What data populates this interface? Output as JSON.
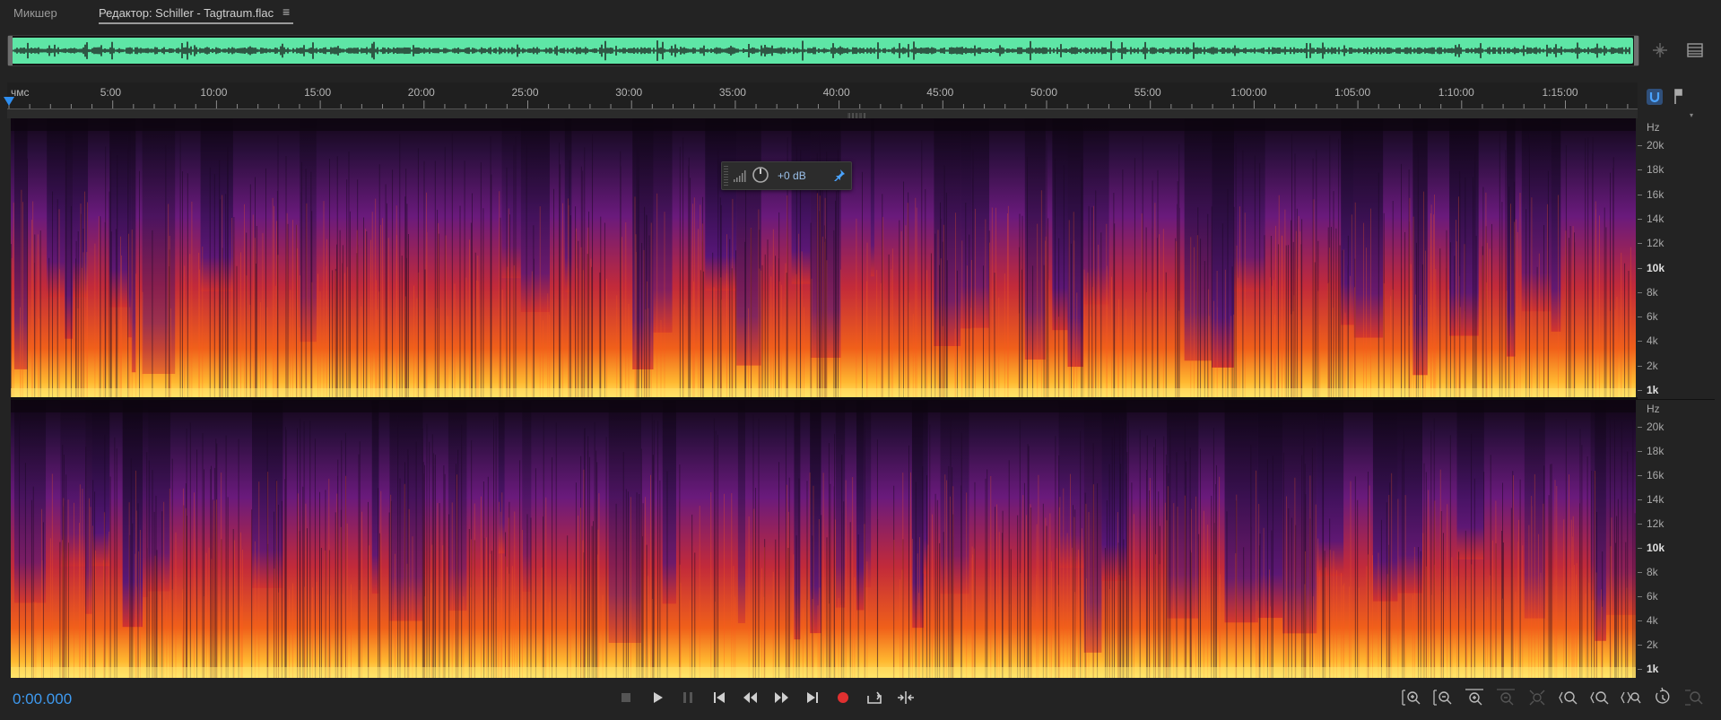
{
  "tabs": [
    {
      "label": "Микшер"
    },
    {
      "label": "Редактор: Schiller - Tagtraum.flac"
    }
  ],
  "tab_menu_icon": "hamburger-menu-icon",
  "ruler": {
    "units_label": "чмс",
    "labels": [
      "5:00",
      "10:00",
      "15:00",
      "20:00",
      "25:00",
      "30:00",
      "35:00",
      "40:00",
      "45:00",
      "50:00",
      "55:00",
      "1:00:00",
      "1:05:00",
      "1:10:00",
      "1:15:00"
    ]
  },
  "hz_scale": {
    "unit": "Hz",
    "labels": [
      "20k",
      "18k",
      "16k",
      "14k",
      "12k",
      "10k",
      "8k",
      "6k",
      "4k",
      "2k",
      "1k"
    ]
  },
  "hud": {
    "gain_value": "+0 dB",
    "icons": [
      "level-bars-icon",
      "volume-knob-icon",
      "pin-icon"
    ]
  },
  "timecode": "0:00.000",
  "transport": [
    "stop-icon",
    "play-icon",
    "pause-icon",
    "go-to-start-icon",
    "rewind-icon",
    "fast-forward-icon",
    "go-to-end-icon",
    "record-icon",
    "loop-playback-icon",
    "skip-selection-icon"
  ],
  "zoom_controls": [
    "zoom-in-amplitude-icon",
    "zoom-out-amplitude-icon",
    "zoom-in-time-icon",
    "zoom-out-time-icon",
    "zoom-out-full-icon",
    "zoom-in-at-in-point-icon",
    "zoom-in-at-out-point-icon",
    "zoom-to-selection-icon",
    "zoom-reset-icon",
    "zoom-selected-tracks-icon"
  ],
  "colors": {
    "accent": "#3e9af0",
    "waveform": "#5ee6a6",
    "record": "#e03030"
  }
}
